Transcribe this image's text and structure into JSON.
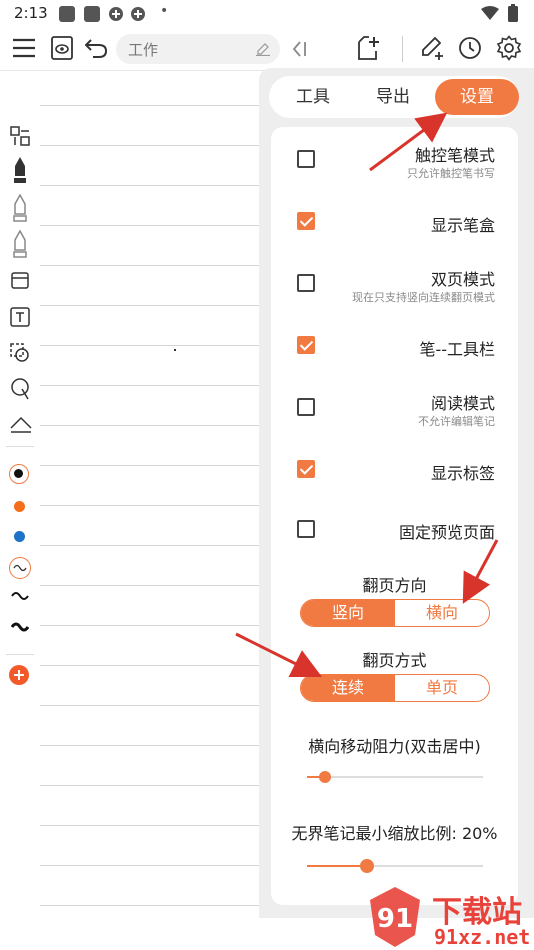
{
  "status_bar": {
    "time": "2:13"
  },
  "toolbar": {
    "search_value": "工作"
  },
  "panel": {
    "tabs": [
      {
        "label": "工具"
      },
      {
        "label": "导出"
      },
      {
        "label": "设置"
      }
    ],
    "options": [
      {
        "label": "触控笔模式",
        "sub": "只允许触控笔书写",
        "checked": false
      },
      {
        "label": "显示笔盒",
        "sub": "",
        "checked": true
      },
      {
        "label": "双页模式",
        "sub": "现在只支持竖向连续翻页模式",
        "checked": false
      },
      {
        "label": "笔--工具栏",
        "sub": "",
        "checked": true
      },
      {
        "label": "阅读模式",
        "sub": "不允许编辑笔记",
        "checked": false
      },
      {
        "label": "显示标签",
        "sub": "",
        "checked": true
      },
      {
        "label": "固定预览页面",
        "sub": "",
        "checked": false
      }
    ],
    "page_direction": {
      "title": "翻页方向",
      "options": [
        "竖向",
        "横向"
      ],
      "selected": 0
    },
    "page_mode": {
      "title": "翻页方式",
      "options": [
        "连续",
        "单页"
      ],
      "selected": 0
    },
    "resistance": {
      "title": "横向移动阻力(双击居中)",
      "value": 0.1
    },
    "min_zoom": {
      "title": "无界笔记最小缩放比例: 20%",
      "value": 0.34
    }
  },
  "colors": {
    "accent": "#f07a42",
    "arrow": "#d8342c"
  },
  "watermark": {
    "text": "下载站",
    "url_text": "91xz.net"
  }
}
